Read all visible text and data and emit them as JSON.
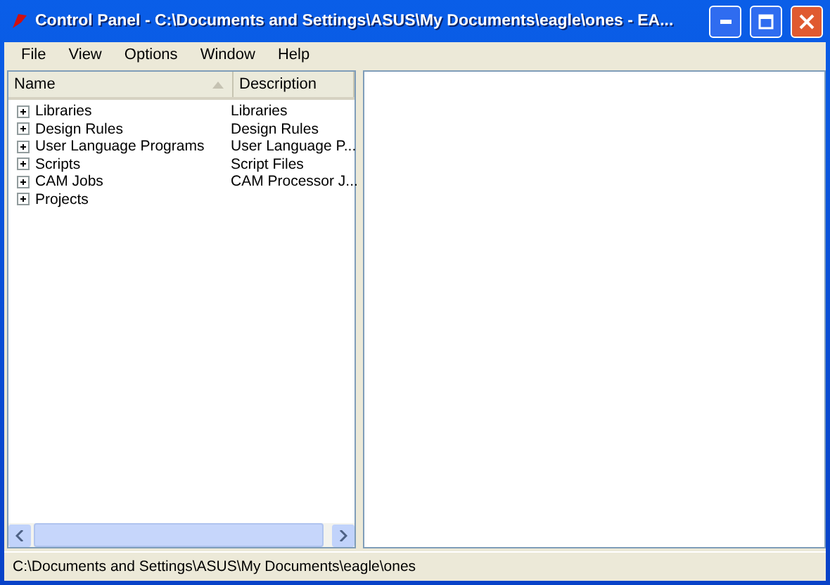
{
  "window": {
    "title": "Control Panel - C:\\Documents and Settings\\ASUS\\My Documents\\eagle\\ones - EA..."
  },
  "menu": [
    "File",
    "View",
    "Options",
    "Window",
    "Help"
  ],
  "tree": {
    "columns": [
      "Name",
      "Description"
    ],
    "items": [
      {
        "name": "Libraries",
        "description": "Libraries",
        "expanded": false
      },
      {
        "name": "Design Rules",
        "description": "Design Rules",
        "expanded": false
      },
      {
        "name": "User Language Programs",
        "description": "User Language P...",
        "expanded": false
      },
      {
        "name": "Scripts",
        "description": "Script Files",
        "expanded": false
      },
      {
        "name": "CAM Jobs",
        "description": "CAM Processor J...",
        "expanded": false
      },
      {
        "name": "Projects",
        "expanded": false
      }
    ]
  },
  "status_bar": "C:\\Documents and Settings\\ASUS\\My Documents\\eagle\\ones"
}
